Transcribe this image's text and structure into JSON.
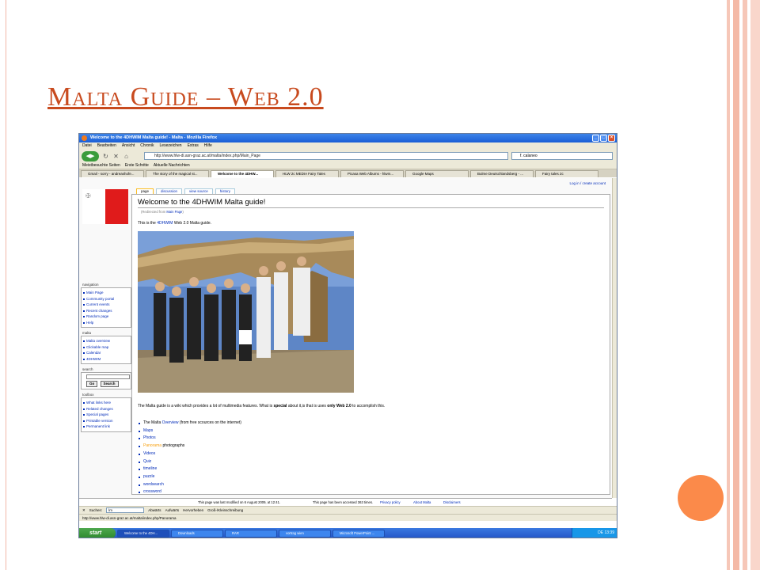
{
  "slide": {
    "title": "Malta Guide – Web 2.0",
    "accent_color": "#c84a1e",
    "dot_color": "#fb8a4a"
  },
  "browser": {
    "window_title": "Welcome to the 4DHWIM Malta guide! - Malta - Mozilla Firefox",
    "menu": [
      "Datei",
      "Bearbeiten",
      "Ansicht",
      "Chronik",
      "Lesezeichen",
      "Extras",
      "Hilfe"
    ],
    "url": "http://www.hlw-di.asn-graz.ac.at/malta/index.php/Main_Page",
    "search_value": "f. calaneo",
    "bookmarks": [
      "Meistbesuchte Seiten",
      "Erste Schritte",
      "Aktuelle Nachrichten"
    ],
    "tabs": [
      {
        "label": "Gmail - sorry - andreashofe...",
        "active": false
      },
      {
        "label": "The story of the magical st...",
        "active": false
      },
      {
        "label": "Welcome to the 4DHW...",
        "active": true
      },
      {
        "label": "HLW 2c MEDIA Fairy Tales",
        "active": false
      },
      {
        "label": "Picasa Web Albums - hlwm...",
        "active": false
      },
      {
        "label": "Google Maps",
        "active": false
      },
      {
        "label": "Bulme Deutschlandsberg - ...",
        "active": false
      },
      {
        "label": "Fairy tales 2c",
        "active": false
      }
    ]
  },
  "wiki": {
    "login_link": "Log in / create account",
    "content_tabs": [
      "page",
      "discussion",
      "view source",
      "history"
    ],
    "page_title": "Welcome to the 4DHWIM Malta guide!",
    "redirected_prefix": "(Redirected from ",
    "redirected_link": "Main Page",
    "redirected_suffix": ")",
    "intro_pre": "This is the ",
    "intro_link": "4DHWIM",
    "intro_post": " Web 2.0 Malta guide.",
    "desc_pre": "The Malta guide is a wiki which provides a lot of multimedia features. What is ",
    "desc_bold1": "special",
    "desc_mid": " about it,is that is uses ",
    "desc_bold2": "only Web 2.0",
    "desc_post": " to accomplish this.",
    "list": {
      "malta_pre": "The Malta ",
      "malta_link": "Overview",
      "malta_post": " (from free scources on the internet)",
      "maps": "Maps",
      "photos": "Photos",
      "panorama_link": "Panorama",
      "panorama_post": " photographs",
      "videos": "Videos",
      "quiz": "Quiz",
      "timeline": "timeline",
      "puzzle": "puzzle",
      "wordsearch": "wordsearch",
      "crossword": "crossword"
    },
    "sidebar": {
      "navigation_heading": "navigation",
      "navigation": [
        "Main Page",
        "Community portal",
        "Current events",
        "Recent changes",
        "Random page",
        "Help"
      ],
      "malta_heading": "malta",
      "malta": [
        "Malta overview",
        "Clickable map",
        "Calendar",
        "4DHWIM"
      ],
      "search_heading": "search",
      "go_label": "Go",
      "search_label": "Search",
      "toolbox_heading": "toolbox",
      "toolbox": [
        "What links here",
        "Related changes",
        "Special pages",
        "Printable version",
        "Permanent link"
      ]
    },
    "footer": {
      "modified": "This page was last modified on 6 August 2009, at 12:41.",
      "accessed": "This page has been accessed 363 times.",
      "privacy": "Privacy policy",
      "about": "About Malta",
      "disclaimers": "Disclaimers"
    }
  },
  "findbar": {
    "close": "✕",
    "label": "Suchen:",
    "value": "lm",
    "down": "Abwärts",
    "up": "Aufwärts",
    "highlight": "Hervorheben",
    "case": "Groß-/Kleinschreibung"
  },
  "status_url": "http://www.hlw-di.asn-graz.ac.at/malta/index.php/Panorama",
  "taskbar": {
    "start": "start",
    "tasks": [
      {
        "label": "Welcome to the 4DH...",
        "active": true
      },
      {
        "label": "Downloads",
        "active": false
      },
      {
        "label": "RAR",
        "active": false
      },
      {
        "label": "vortrag wien",
        "active": false
      },
      {
        "label": "Microsoft PowerPoint ...",
        "active": false
      }
    ],
    "tray_lang": "DE",
    "clock": "13:39"
  }
}
